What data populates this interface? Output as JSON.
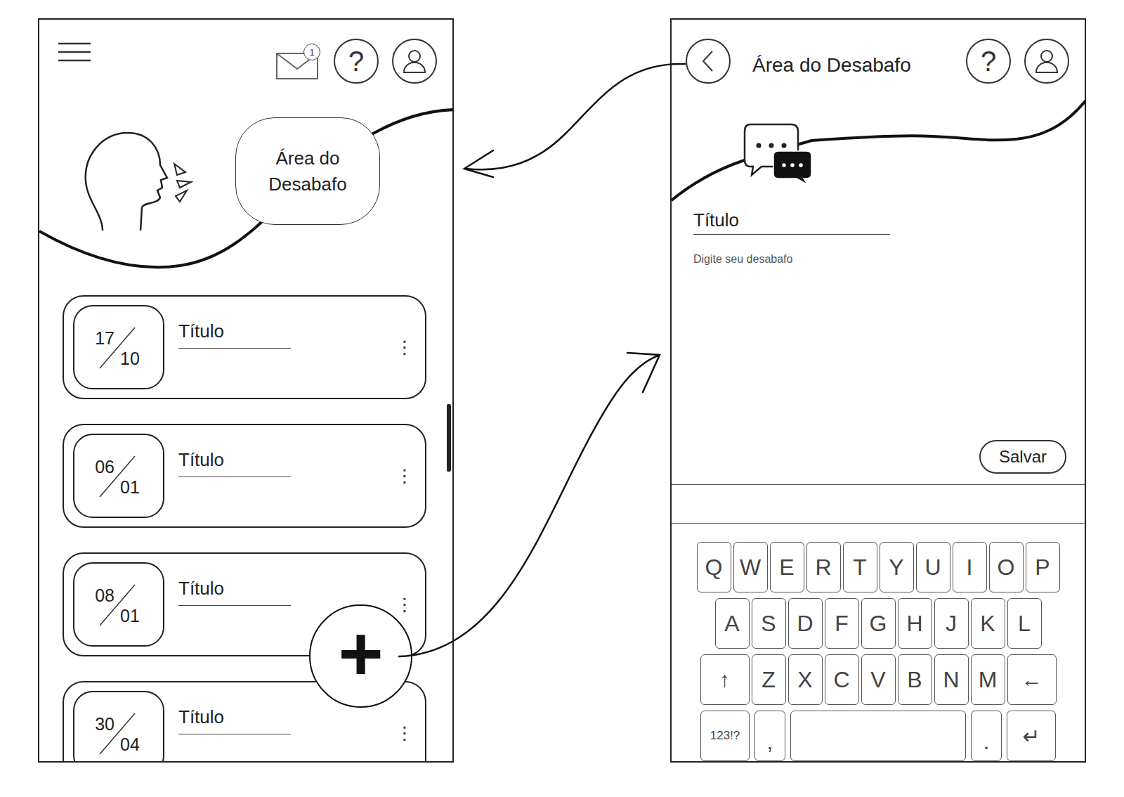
{
  "list_screen": {
    "notification_count": "1",
    "help_label": "?",
    "banner_title": "Área do Desabafo",
    "more_label": "⋮",
    "add_label": "+",
    "entries": [
      {
        "day": "17",
        "month": "10",
        "title": "Título"
      },
      {
        "day": "06",
        "month": "01",
        "title": "Título"
      },
      {
        "day": "08",
        "month": "01",
        "title": "Título"
      },
      {
        "day": "30",
        "month": "04",
        "title": "Título"
      }
    ]
  },
  "editor_screen": {
    "title": "Área do Desabafo",
    "help_label": "?",
    "title_field": "Título",
    "placeholder": "Digite seu desabafo",
    "save_button": "Salvar",
    "keyboard": {
      "rows": [
        [
          {
            "label": "Q",
            "kind": "letter"
          },
          {
            "label": "W",
            "kind": "letter"
          },
          {
            "label": "E",
            "kind": "letter"
          },
          {
            "label": "R",
            "kind": "letter"
          },
          {
            "label": "T",
            "kind": "letter"
          },
          {
            "label": "Y",
            "kind": "letter"
          },
          {
            "label": "U",
            "kind": "letter"
          },
          {
            "label": "I",
            "kind": "letter"
          },
          {
            "label": "O",
            "kind": "letter"
          },
          {
            "label": "P",
            "kind": "letter"
          }
        ],
        [
          {
            "label": "A",
            "kind": "letter"
          },
          {
            "label": "S",
            "kind": "letter"
          },
          {
            "label": "D",
            "kind": "letter"
          },
          {
            "label": "F",
            "kind": "letter"
          },
          {
            "label": "G",
            "kind": "letter"
          },
          {
            "label": "H",
            "kind": "letter"
          },
          {
            "label": "J",
            "kind": "letter"
          },
          {
            "label": "K",
            "kind": "letter"
          },
          {
            "label": "L",
            "kind": "letter"
          }
        ],
        [
          {
            "label": "↑",
            "kind": "action"
          },
          {
            "label": "Z",
            "kind": "letter"
          },
          {
            "label": "X",
            "kind": "letter"
          },
          {
            "label": "C",
            "kind": "letter"
          },
          {
            "label": "V",
            "kind": "letter"
          },
          {
            "label": "B",
            "kind": "letter"
          },
          {
            "label": "N",
            "kind": "letter"
          },
          {
            "label": "M",
            "kind": "letter"
          },
          {
            "label": "←",
            "kind": "action"
          }
        ],
        [
          {
            "label": "123!?",
            "kind": "mode"
          },
          {
            "label": ",",
            "kind": "punct"
          },
          {
            "label": "",
            "kind": "space"
          },
          {
            "label": ".",
            "kind": "punct"
          },
          {
            "label": "↵",
            "kind": "action"
          }
        ]
      ]
    }
  }
}
